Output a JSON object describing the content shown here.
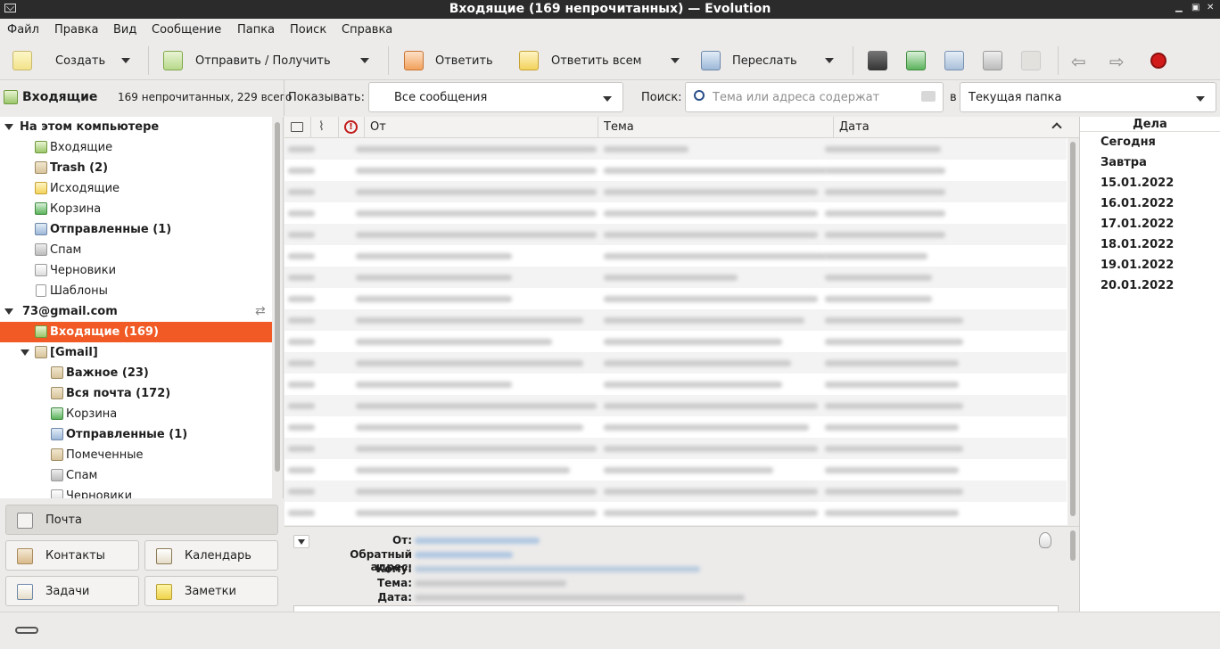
{
  "window": {
    "title": "Входящие (169 непрочитанных) — Evolution"
  },
  "menu": [
    "Файл",
    "Правка",
    "Вид",
    "Сообщение",
    "Папка",
    "Поиск",
    "Справка"
  ],
  "toolbar": {
    "new_label": "Создать",
    "send_receive_label": "Отправить / Получить",
    "reply_label": "Ответить",
    "reply_all_label": "Ответить всем",
    "forward_label": "Переслать"
  },
  "folder_header": {
    "name": "Входящие",
    "counts": "169 непрочитанных, 229 всего"
  },
  "filter": {
    "show_label": "Показывать:",
    "show_value": "Все сообщения",
    "search_label": "Поиск:",
    "search_placeholder": "Тема или адреса содержат",
    "in_label": "в",
    "scope_value": "Текущая папка"
  },
  "tree": {
    "local_title": "На этом компьютере",
    "local": [
      {
        "label": "Входящие",
        "bold": false,
        "icon": "inbox-icon"
      },
      {
        "label": "Trash (2)",
        "bold": true,
        "icon": "trash-icon"
      },
      {
        "label": "Исходящие",
        "bold": false,
        "icon": "outbox-icon"
      },
      {
        "label": "Корзина",
        "bold": false,
        "icon": "recycle-icon"
      },
      {
        "label": "Отправленные (1)",
        "bold": true,
        "icon": "sent-icon"
      },
      {
        "label": "Спам",
        "bold": false,
        "icon": "spam-icon"
      },
      {
        "label": "Черновики",
        "bold": false,
        "icon": "drafts-icon"
      },
      {
        "label": "Шаблоны",
        "bold": false,
        "icon": "templates-icon"
      }
    ],
    "account_title": "73@gmail.com",
    "account_inbox": "Входящие (169)",
    "gmail_title": "[Gmail]",
    "gmail": [
      {
        "label": "Важное (23)",
        "bold": true,
        "icon": "folder-icon"
      },
      {
        "label": "Вся почта (172)",
        "bold": true,
        "icon": "folder-icon"
      },
      {
        "label": "Корзина",
        "bold": false,
        "icon": "recycle-icon"
      },
      {
        "label": "Отправленные (1)",
        "bold": true,
        "icon": "sent-icon"
      },
      {
        "label": "Помеченные",
        "bold": false,
        "icon": "folder-icon"
      },
      {
        "label": "Спам",
        "bold": false,
        "icon": "spam-icon"
      },
      {
        "label": "Черновики",
        "bold": false,
        "icon": "drafts-icon"
      }
    ]
  },
  "switcher": {
    "mail": "Почта",
    "contacts": "Контакты",
    "calendar": "Календарь",
    "tasks": "Задачи",
    "memos": "Заметки"
  },
  "list": {
    "col_from": "От",
    "col_subject": "Тема",
    "col_date": "Дата"
  },
  "preview": {
    "from_label": "От:",
    "reply_to_label": "Обратный адрес:",
    "to_label": "Кому:",
    "subject_label": "Тема:",
    "date_label": "Дата:"
  },
  "tasks_pane": {
    "title": "Дела",
    "days": [
      "Сегодня",
      "Завтра",
      "15.01.2022",
      "16.01.2022",
      "17.01.2022",
      "18.01.2022",
      "19.01.2022",
      "20.01.2022"
    ]
  },
  "colors": {
    "selection": "#f15a24",
    "titlebar": "#2b2b2b",
    "stop": "#d31a1a"
  }
}
